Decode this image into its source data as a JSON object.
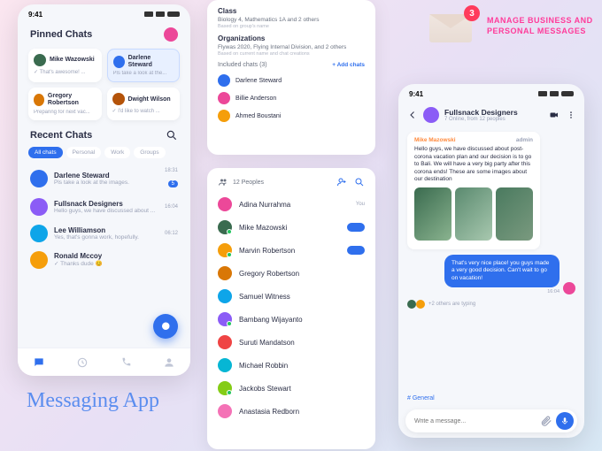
{
  "statusTime": "9:41",
  "caption": "Messaging App",
  "headline": "MANAGE BUSINESS AND PERSONAL MESSAGES",
  "envelopeBadge": "3",
  "phone1": {
    "pinnedTitle": "Pinned Chats",
    "recentTitle": "Recent Chats",
    "pinned": [
      {
        "name": "Mike Wazowski",
        "msg": "✓ That's awesome! ...",
        "color": "#3a6b4f"
      },
      {
        "name": "Darlene Steward",
        "msg": "Pls take a look at the...",
        "color": "#2f6fed",
        "active": true
      },
      {
        "name": "Gregory Robertson",
        "msg": "Preparing for next vac...",
        "color": "#d97706"
      },
      {
        "name": "Dwight Wilson",
        "msg": "✓ I'd like to watch ...",
        "color": "#b45309"
      }
    ],
    "tabs": [
      "All chats",
      "Personal",
      "Work",
      "Groups"
    ],
    "recent": [
      {
        "name": "Darlene Steward",
        "msg": "Pls take a look at the images.",
        "time": "18:31",
        "badge": "5",
        "color": "#2f6fed"
      },
      {
        "name": "Fullsnack Designers",
        "msg": "Hello guys, we have discussed about ...",
        "time": "16:04",
        "color": "#8b5cf6"
      },
      {
        "name": "Lee Williamson",
        "msg": "Yes, that's gonna work, hopefully.",
        "time": "06:12",
        "color": "#0ea5e9"
      },
      {
        "name": "Ronald Mccoy",
        "msg": "✓ Thanks dude 😊",
        "time": "",
        "color": "#f59e0b"
      }
    ]
  },
  "panel2": {
    "classTitle": "Class",
    "classValue": "Biology 4, Mathematics 1A and 2 others",
    "classHint": "Based on group's name",
    "orgTitle": "Organizations",
    "orgValue": "Flywas 2020, Flying Internal Division, and 2 others",
    "orgHint": "Based on current name and chat creations",
    "includedTitle": "Included chats (3)",
    "addLink": "+ Add chats",
    "included": [
      {
        "name": "Darlene Steward",
        "color": "#2f6fed"
      },
      {
        "name": "Billie Anderson",
        "color": "#ec4899"
      },
      {
        "name": "Ahmed Boustani",
        "color": "#f59e0b"
      }
    ]
  },
  "panel3": {
    "count": "12 Peoples",
    "people": [
      {
        "name": "Adina Nurrahma",
        "tag": "You",
        "color": "#ec4899"
      },
      {
        "name": "Mike Mazowski",
        "pill": true,
        "online": true,
        "color": "#3a6b4f"
      },
      {
        "name": "Marvin Robertson",
        "pill": true,
        "online": true,
        "color": "#f59e0b"
      },
      {
        "name": "Gregory Robertson",
        "color": "#d97706"
      },
      {
        "name": "Samuel Witness",
        "color": "#0ea5e9"
      },
      {
        "name": "Bambang Wijayanto",
        "online": true,
        "color": "#8b5cf6"
      },
      {
        "name": "Suruti Mandatson",
        "color": "#ef4444"
      },
      {
        "name": "Michael Robbin",
        "color": "#06b6d4"
      },
      {
        "name": "Jackobs Stewart",
        "online": true,
        "color": "#84cc16"
      },
      {
        "name": "Anastasia Redborn",
        "color": "#f472b6"
      }
    ]
  },
  "phone3": {
    "title": "Fullsnack Designers",
    "subtitle": "7 Online, from 12 peoples",
    "sender": "Mike Mazowski",
    "senderTag": "admin",
    "msgIn": "Hello guys, we have discussed about post-corona vacation plan and our decision is to go to Bali. We will have a very big party after this corona ends! These are some images about our destination",
    "msgOut": "That's very nice place! you guys made a very good decision. Can't wait to go on vacation!",
    "msgOutTime": "16:04",
    "typing": "+2 others are typing",
    "channel": "# General",
    "composerPlaceholder": "Write a message..."
  }
}
